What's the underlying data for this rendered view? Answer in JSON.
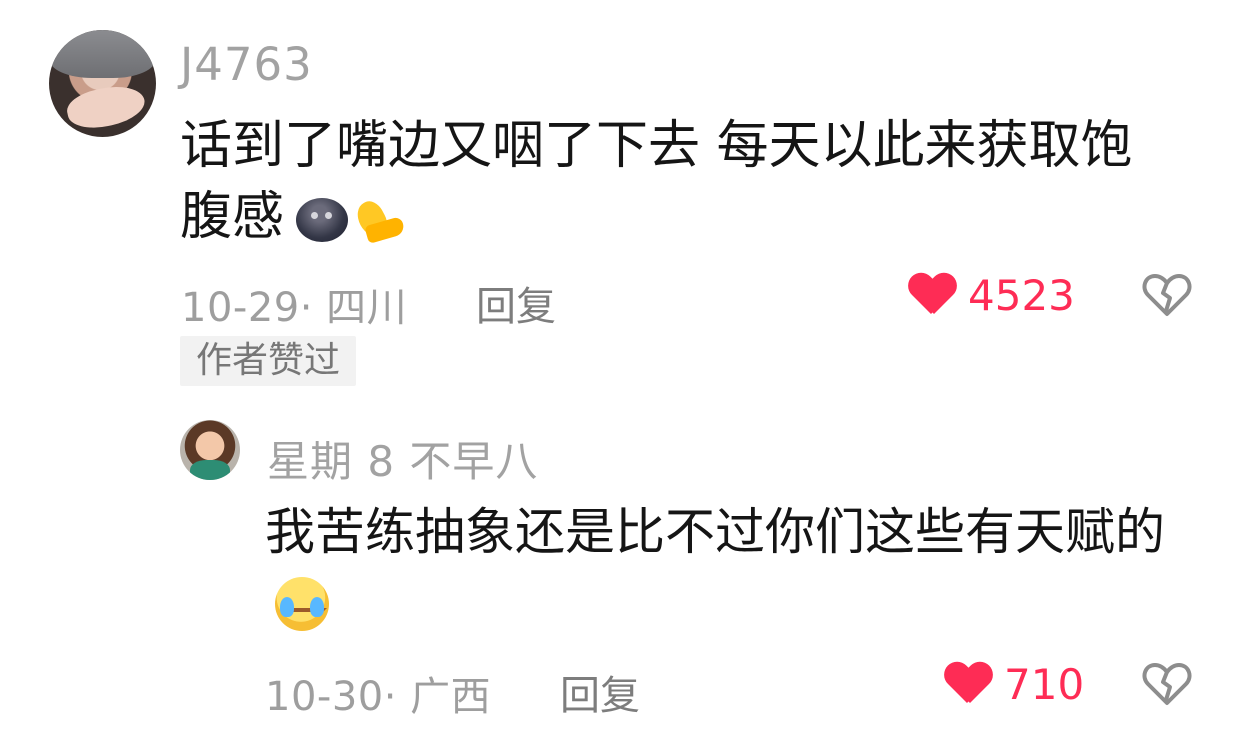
{
  "comments": [
    {
      "username": "J4763",
      "text": "话到了嘴边又咽了下去 每天以此来获取饱腹感",
      "emoji_icons": [
        "new-moon-face-icon",
        "flexed-biceps-icon"
      ],
      "meta": "10-29· 四川",
      "reply_label": "回复",
      "likes": "4523",
      "badge": "作者赞过"
    },
    {
      "username": "星期 8 不早八",
      "text": "我苦练抽象还是比不过你们这些有天赋的",
      "emoji_icons": [
        "crying-face-icon"
      ],
      "meta": "10-30· 广西",
      "reply_label": "回复",
      "likes": "710"
    }
  ],
  "colors": {
    "like_red": "#fe2c55",
    "meta_gray": "#9e9e9e",
    "username_gray": "#a2a2a2",
    "badge_bg": "#f2f2f2"
  }
}
